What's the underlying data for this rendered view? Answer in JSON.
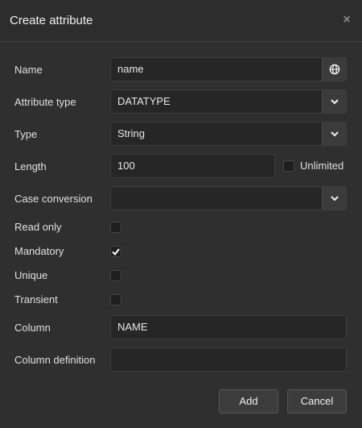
{
  "dialog": {
    "title": "Create attribute",
    "close_glyph": "×"
  },
  "form": {
    "name": {
      "label": "Name",
      "value": "name",
      "button_icon": "globe-icon"
    },
    "attribute_type": {
      "label": "Attribute type",
      "value": "DATATYPE"
    },
    "type": {
      "label": "Type",
      "value": "String"
    },
    "length": {
      "label": "Length",
      "value": "100",
      "unlimited_label": "Unlimited",
      "unlimited_checked": false
    },
    "case_conversion": {
      "label": "Case conversion",
      "value": ""
    },
    "read_only": {
      "label": "Read only",
      "checked": false
    },
    "mandatory": {
      "label": "Mandatory",
      "checked": true
    },
    "unique": {
      "label": "Unique",
      "checked": false
    },
    "transient": {
      "label": "Transient",
      "checked": false
    },
    "column": {
      "label": "Column",
      "value": "NAME"
    },
    "column_definition": {
      "label": "Column definition",
      "value": ""
    }
  },
  "buttons": {
    "add": "Add",
    "cancel": "Cancel"
  },
  "colors": {
    "background": "#2f2f2f",
    "field_bg": "#262626",
    "text": "#e6e6e6"
  }
}
